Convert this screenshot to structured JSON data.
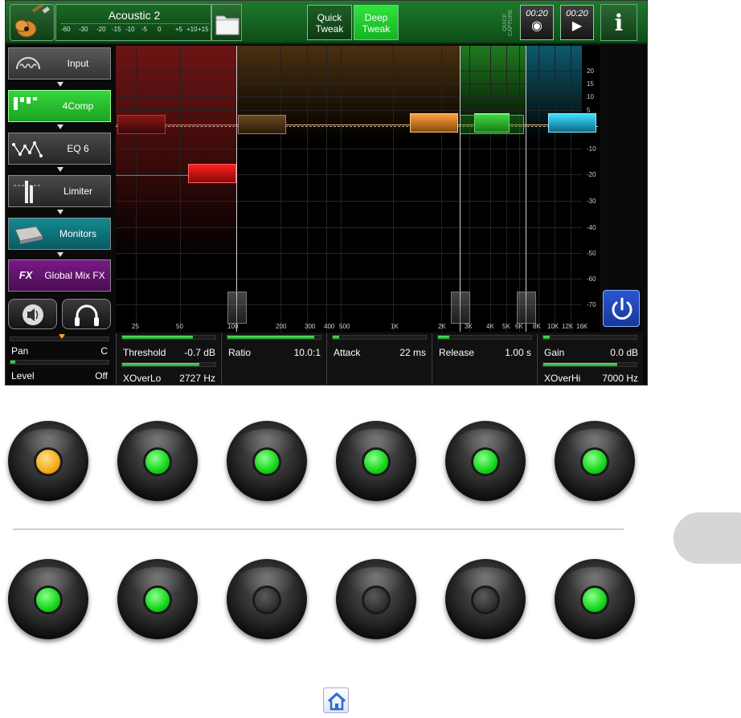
{
  "preset": {
    "name": "Acoustic 2"
  },
  "meter_scale": [
    "-60",
    "-30",
    "-20",
    "-15",
    "-10",
    "-5",
    "0",
    "+5",
    "+10",
    "+15"
  ],
  "tweak": {
    "quick": "Quick\nTweak",
    "deep": "Deep\nTweak",
    "quick_l1": "Quick",
    "quick_l2": "Tweak",
    "deep_l1": "Deep",
    "deep_l2": "Tweak"
  },
  "quick_capture_label": "QUICK CAPTURE",
  "timers": {
    "capture": "00:20",
    "play": "00:20"
  },
  "info_label": "i",
  "blocks": {
    "input": "Input",
    "comp": "4Comp",
    "eq": "EQ 6",
    "limiter": "Limiter",
    "monitors": "Monitors",
    "gfx": "Global Mix FX",
    "gfx_badge": "FX"
  },
  "pan": {
    "label": "Pan",
    "value": "C"
  },
  "level": {
    "label": "Level",
    "value": "Off"
  },
  "graph": {
    "db_ticks": [
      "20",
      "15",
      "10",
      "5",
      "-10",
      "-20",
      "-30",
      "-40",
      "-50",
      "-60",
      "-70"
    ],
    "freq_ticks": [
      "25",
      "50",
      "100",
      "200",
      "300",
      "400",
      "500",
      "1K",
      "2K",
      "3K",
      "4K",
      "5K",
      "6K",
      "8K",
      "10K",
      "12K",
      "16K"
    ]
  },
  "params": {
    "threshold": {
      "label": "Threshold",
      "value": "-0.7 dB"
    },
    "xoverlo": {
      "label": "XOverLo",
      "value": "2727 Hz"
    },
    "ratio": {
      "label": "Ratio",
      "value": "10.0:1"
    },
    "attack": {
      "label": "Attack",
      "value": "22 ms"
    },
    "release": {
      "label": "Release",
      "value": "1.00 s"
    },
    "gain": {
      "label": "Gain",
      "value": "0.0 dB"
    },
    "xoverhi": {
      "label": "XOverHi",
      "value": "7000 Hz"
    }
  },
  "footswitches": {
    "row1": [
      "amber",
      "green",
      "green",
      "green",
      "green",
      "green"
    ],
    "row2": [
      "green",
      "green",
      "off",
      "off",
      "off",
      "green"
    ]
  },
  "colors": {
    "accent_green": "#1aa322",
    "low_band": "#8a1515",
    "lowmid_band": "#5a3a12",
    "himid_band": "#1a6e1a",
    "high_band": "#0d5a6e",
    "power": "#2a55d0"
  }
}
